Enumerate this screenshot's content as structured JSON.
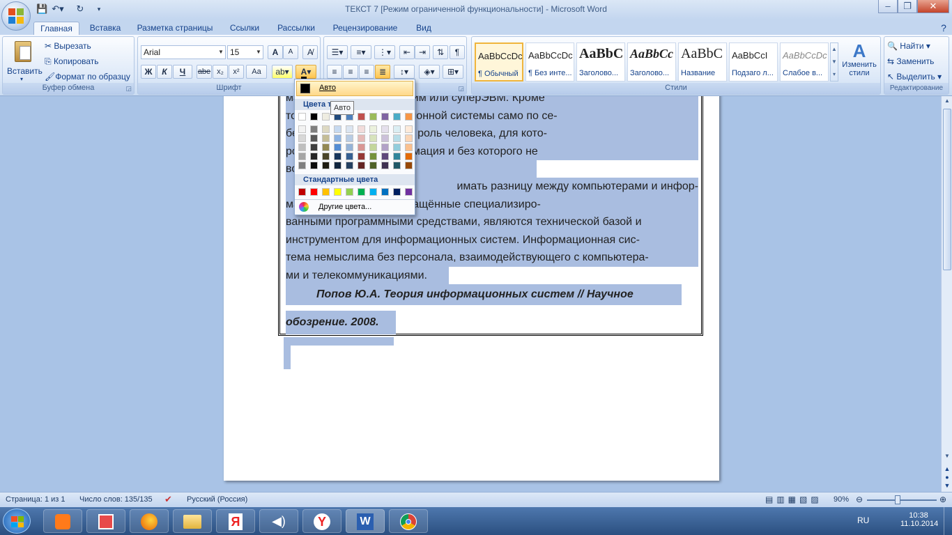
{
  "window": {
    "title": "ТЕКСТ 7 [Режим ограниченной функциональности] - Microsoft Word",
    "min": "–",
    "max": "❐",
    "close": "✕"
  },
  "tabs": [
    "Главная",
    "Вставка",
    "Разметка страницы",
    "Ссылки",
    "Рассылки",
    "Рецензирование",
    "Вид"
  ],
  "clipboard": {
    "paste": "Вставить",
    "cut": "Вырезать",
    "copy": "Копировать",
    "format_painter": "Формат по образцу",
    "group_label": "Буфер обмена"
  },
  "font": {
    "name": "Arial",
    "size": "15",
    "group_label": "Шрифт",
    "bold": "Ж",
    "italic": "К",
    "underline": "Ч",
    "strike": "abe",
    "sub": "x₂",
    "sup": "x²",
    "case": "Aa",
    "grow": "A",
    "shrink": "A"
  },
  "paragraph": {
    "group_label": "Абзац"
  },
  "styles": {
    "group_label": "Стили",
    "items": [
      {
        "sample": "AaBbCcDc",
        "name": "¶ Обычный"
      },
      {
        "sample": "AaBbCcDc",
        "name": "¶ Без инте..."
      },
      {
        "sample": "AaBbC",
        "name": "Заголово..."
      },
      {
        "sample": "AaBbCc",
        "name": "Заголово..."
      },
      {
        "sample": "AaBbC",
        "name": "Название"
      },
      {
        "sample": "AaBbCcI",
        "name": "Подзаго л..."
      },
      {
        "sample": "AaBbCcDc",
        "name": "Слабое в..."
      }
    ],
    "change_styles": "Изменить стили"
  },
  "editing": {
    "group_label": "Редактирование",
    "find": "Найти",
    "replace": "Заменить",
    "select": "Выделить"
  },
  "color_popup": {
    "auto": "Авто",
    "theme_colors": "Цвета т",
    "standard_colors": "Стандартные цвета",
    "more_colors": "Другие цвета...",
    "tooltip": "Авто",
    "theme_top": [
      "#ffffff",
      "#000000",
      "#eeece1",
      "#1f497d",
      "#4f81bd",
      "#c0504d",
      "#9bbb59",
      "#8064a2",
      "#4bacc6",
      "#f79646"
    ],
    "theme_shades": [
      [
        "#f2f2f2",
        "#7f7f7f",
        "#ddd9c3",
        "#c6d9f0",
        "#dbe5f1",
        "#f2dcdb",
        "#ebf1dd",
        "#e5e0ec",
        "#dbeef3",
        "#fdeada"
      ],
      [
        "#d8d8d8",
        "#595959",
        "#c4bd97",
        "#8db3e2",
        "#b8cce4",
        "#e5b9b7",
        "#d7e3bc",
        "#ccc1d9",
        "#b7dde8",
        "#fbd5b5"
      ],
      [
        "#bfbfbf",
        "#3f3f3f",
        "#938953",
        "#548dd4",
        "#95b3d7",
        "#d99694",
        "#c3d69b",
        "#b2a2c7",
        "#92cddc",
        "#fac08f"
      ],
      [
        "#a5a5a5",
        "#262626",
        "#494429",
        "#17365d",
        "#366092",
        "#953734",
        "#76923c",
        "#5f497a",
        "#31859b",
        "#e36c09"
      ],
      [
        "#7f7f7f",
        "#0c0c0c",
        "#1d1b10",
        "#0f243e",
        "#244061",
        "#632423",
        "#4f6128",
        "#3f3151",
        "#205867",
        "#974806"
      ]
    ],
    "standard": [
      "#c00000",
      "#ff0000",
      "#ffc000",
      "#ffff00",
      "#92d050",
      "#00b050",
      "#00b0f0",
      "#0070c0",
      "#002060",
      "#7030a0"
    ]
  },
  "document": {
    "para1_lines": [
      "ма              компьютер, мэйнфрейм или суперЭВМ. Кроме",
      "то              площение информационной системы само по се-",
      "бе              ачить, если не учтена роль человека, для кото-",
      "ро              производимая информация и без которого не",
      "во              е и представление."
    ],
    "para2_lines": [
      "              имать разницу между компьютерами и инфор-",
      "ма              ми. Компьютеры, оснащённые специализиро-",
      "ванными программными средствами, являются технической базой и",
      "инструментом для информационных систем. Информационная сис-",
      "тема немыслима без персонала, взаимодействующего с компьютера-",
      "ми и телекоммуникациями."
    ],
    "citation_line1": "Попов Ю.А. Теория информационных систем // Научное",
    "citation_line2": "обозрение. 2008."
  },
  "status": {
    "page": "Страница: 1 из 1",
    "words": "Число слов: 135/135",
    "language": "Русский (Россия)",
    "zoom": "90%"
  },
  "taskbar": {
    "lang": "RU",
    "time": "10:38",
    "date": "11.10.2014"
  }
}
